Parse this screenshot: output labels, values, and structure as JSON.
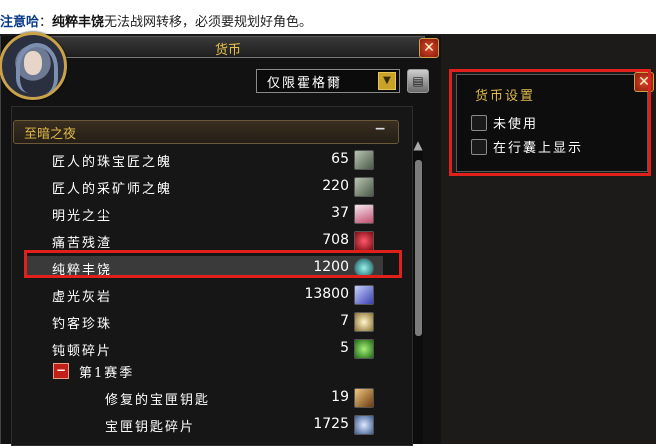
{
  "note": {
    "label": "注意哈",
    "colon": "：",
    "subject": "纯粹丰饶",
    "text": "无法战网转移，必须要规划好角色。"
  },
  "window": {
    "title": "货币",
    "close": "✕",
    "filter_value": "仅限霍格爾",
    "dropdown_arrow": "▼",
    "gear": "▤"
  },
  "category": {
    "label": "至暗之夜",
    "collapse": "−"
  },
  "rows": [
    {
      "name": "匠人的珠宝匠之魄",
      "count": "65",
      "icon_color": "#8a9a88"
    },
    {
      "name": "匠人的采矿师之魄",
      "count": "220",
      "icon_color": "#8a9a88"
    },
    {
      "name": "明光之尘",
      "count": "37",
      "icon_color": "#d48a9a"
    },
    {
      "name": "痛苦残渣",
      "count": "708",
      "icon_color": "#c0182a"
    },
    {
      "name": "纯粹丰饶",
      "count": "1200",
      "icon_color": "#2aa0a0"
    },
    {
      "name": "虚光灰岩",
      "count": "13800",
      "icon_color": "#6a7ae0"
    },
    {
      "name": "钓客珍珠",
      "count": "7",
      "icon_color": "#d6c070"
    },
    {
      "name": "钝顿碎片",
      "count": "5",
      "icon_color": "#48b03a"
    }
  ],
  "season": {
    "toggle": "−",
    "label": "第1赛季"
  },
  "season_rows": [
    {
      "name": "修复的宝匣钥匙",
      "count": "19",
      "icon_color": "#c08a3a"
    },
    {
      "name": "宝匣钥匙碎片",
      "count": "1725",
      "icon_color": "#6a8ab8"
    }
  ],
  "scrollbar": {
    "up": "▲"
  },
  "settings": {
    "title": "货币设置",
    "close": "✕",
    "options": [
      {
        "label": "未使用",
        "checked": false
      },
      {
        "label": "在行囊上显示",
        "checked": false
      }
    ]
  }
}
